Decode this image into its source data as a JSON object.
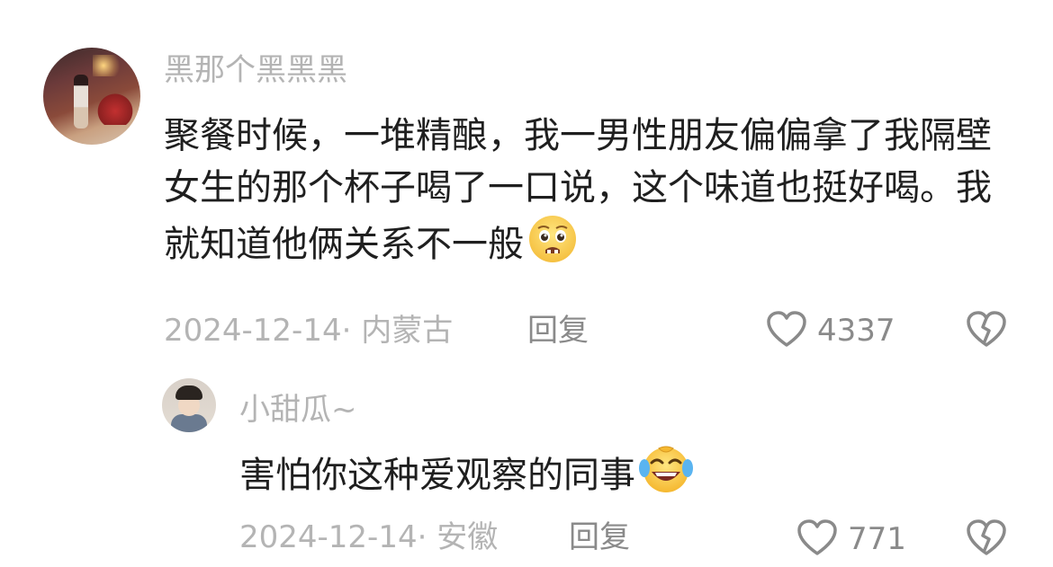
{
  "comments": [
    {
      "username": "黑那个黑黑黑",
      "text": "聚餐时候，一堆精酿，我一男性朋友偏偏拿了我隔壁女生的那个杯子喝了一口说，这个味道也挺好喝。我就知道他俩关系不一般",
      "emoji": "pleading-face-emoji",
      "date": "2024-12-14",
      "location": "内蒙古",
      "reply_label": "回复",
      "likes": "4337"
    },
    {
      "username": "小甜瓜~",
      "text": "害怕你这种爱观察的同事",
      "emoji": "laughing-crying-emoji",
      "date": "2024-12-14",
      "location": "安徽",
      "reply_label": "回复",
      "likes": "771"
    }
  ],
  "meta_separator": "· ",
  "colors": {
    "text": "#1f1f1f",
    "muted": "#b4b4b4",
    "action": "#8a8a8a",
    "icon_stroke": "#8a8a8a"
  }
}
